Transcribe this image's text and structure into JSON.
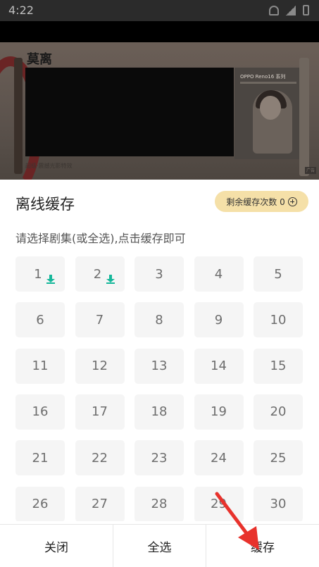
{
  "status_bar": {
    "time": "4:22"
  },
  "video": {
    "calligraphy_title": "莫离",
    "ad_title": "OPPO Reno16 系列",
    "caption": "超级·震撼光影特效",
    "corner_badge": "广告"
  },
  "sheet": {
    "title": "离线缓存",
    "remaining_label": "剩余缓存次数 0",
    "hint": "请选择剧集(或全选),点击缓存即可",
    "episodes": [
      "1",
      "2",
      "3",
      "4",
      "5",
      "6",
      "7",
      "8",
      "9",
      "10",
      "11",
      "12",
      "13",
      "14",
      "15",
      "16",
      "17",
      "18",
      "19",
      "20",
      "21",
      "22",
      "23",
      "24",
      "25",
      "26",
      "27",
      "28",
      "29",
      "30"
    ],
    "downloaded": [
      "1",
      "2"
    ]
  },
  "actions": {
    "close": "关闭",
    "select_all": "全选",
    "cache": "缓存"
  },
  "colors": {
    "accent_green": "#16b79a",
    "badge_bg": "#f5e0a8",
    "annotation_red": "#e8322c"
  }
}
